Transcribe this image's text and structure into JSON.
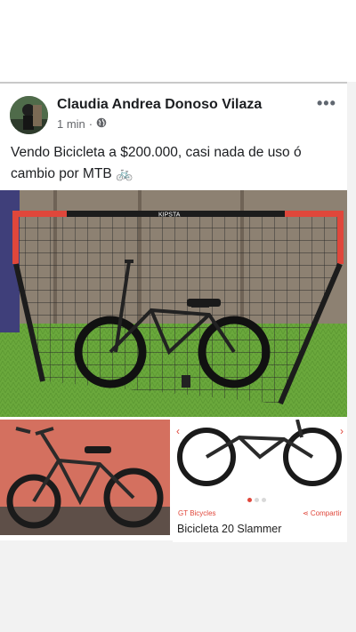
{
  "post": {
    "author": "Claudia Andrea Donoso Vilaza",
    "time": "1 min",
    "separator": "·",
    "text": "Vendo Bicicleta a $200.000, casi nada de uso ó cambio por MTB 🚲",
    "more_icon": "more-horizontal-icon",
    "privacy_icon": "globe-icon"
  },
  "images": {
    "main_net_brand": "KIPSTA",
    "shop": {
      "brand": "GT Bicycles",
      "share": "Compartir",
      "title": "Bicicleta 20 Slammer"
    }
  },
  "colors": {
    "accent": "#e0473b",
    "name_text": "#1c1e21",
    "meta_text": "#65676b"
  }
}
